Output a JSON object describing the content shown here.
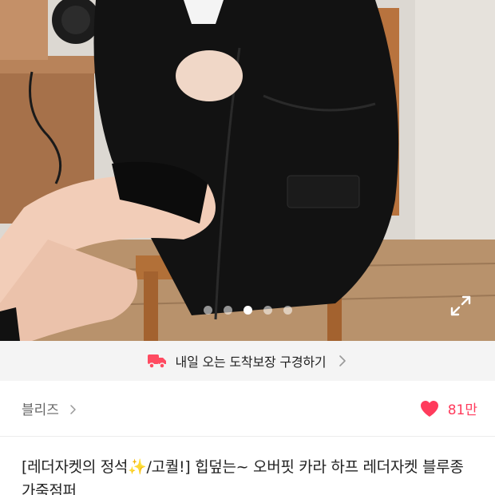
{
  "product": {
    "image_carousel": {
      "page_count": 5,
      "active_index": 2
    }
  },
  "delivery_banner": {
    "label": "내일 오는 도착보장 구경하기",
    "icon": "truck-icon",
    "accent_color": "#ff4b61"
  },
  "brand_row": {
    "brand_name": "블리즈",
    "like_count": "81만",
    "like_color": "#ff3b5c"
  },
  "title": {
    "part1": "[레더자켓의 정석",
    "sparkle": "✨",
    "part2": "/고퀄!] 힙덮는~ 오버핏 카라 하프 레더자켓 블루종 가죽점퍼"
  },
  "icons": {
    "expand": "expand-icon",
    "chevron": "chevron-right-icon",
    "heart": "heart-icon"
  }
}
